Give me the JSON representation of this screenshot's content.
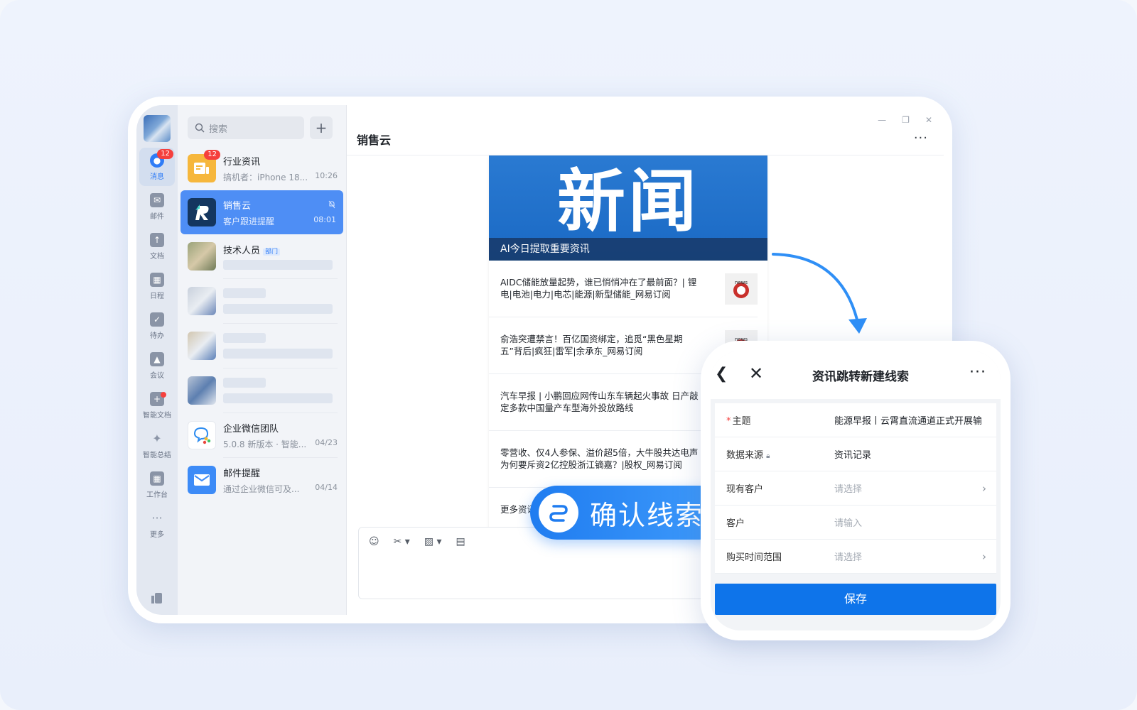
{
  "rail": {
    "items": [
      {
        "label": "消息",
        "icon": "chat-bubble-icon",
        "badge": "12",
        "active": true
      },
      {
        "label": "邮件",
        "icon": "mail-icon"
      },
      {
        "label": "文档",
        "icon": "document-icon"
      },
      {
        "label": "日程",
        "icon": "calendar-icon"
      },
      {
        "label": "待办",
        "icon": "todo-check-icon"
      },
      {
        "label": "会议",
        "icon": "meeting-icon"
      },
      {
        "label": "智能文档",
        "icon": "smart-doc-icon",
        "dot": true
      },
      {
        "label": "智能总结",
        "icon": "sparkle-icon"
      },
      {
        "label": "工作台",
        "icon": "grid-apps-icon"
      },
      {
        "label": "更多",
        "icon": "more-dots-icon"
      }
    ]
  },
  "search": {
    "placeholder": "搜索"
  },
  "sessions": [
    {
      "name": "行业资讯",
      "preview": "搞机者：iPhone 18...",
      "time": "10:26",
      "badge": "12"
    },
    {
      "name": "销售云",
      "preview": "客户跟进提醒",
      "time": "08:01",
      "active": true,
      "muted": true
    },
    {
      "name": "技术人员",
      "tag": "部门"
    },
    {
      "name": "企业微信团队",
      "preview": "5.0.8 新版本 · 智能...",
      "time": "04/23"
    },
    {
      "name": "邮件提醒",
      "preview": "通过企业微信可及...",
      "time": "04/14"
    }
  ],
  "chat": {
    "title": "销售云",
    "more": "···",
    "news": {
      "banner_title": "新闻",
      "banner_subtitle": "AI今日提取重要资讯",
      "items": [
        {
          "text": "AIDC储能放量起势，谁已悄悄冲在了最前面？| 锂电|电池|电力|电芯|能源|新型储能_网易订阅"
        },
        {
          "text": "俞浩突遭禁言！百亿国资绑定，追觅“黑色星期五”背后|疯狂|雷军|余承东_网易订阅"
        },
        {
          "text": "汽车早报 | 小鹏回应网传山东车辆起火事故 日产敲定多款中国量产车型海外投放路线"
        },
        {
          "text": "零营收、仅4人参保、溢价超5倍，大牛股共达电声为何要斥资2亿控股浙江镝嘉？|股权_网易订阅"
        }
      ],
      "more_label": "更多资讯"
    }
  },
  "pill": {
    "label": "确认线索"
  },
  "phone": {
    "title": "资讯跳转新建线索",
    "more": "···",
    "fields": [
      {
        "label": "主题",
        "required": true,
        "value": "能源早报丨云霄直流通道正式开展输",
        "placeholder": false
      },
      {
        "label": "数据来源",
        "locked": true,
        "value": "资讯记录",
        "placeholder": false
      },
      {
        "label": "现有客户",
        "value": "请选择",
        "placeholder": true,
        "chevron": true
      },
      {
        "label": "客户",
        "value": "请输入",
        "placeholder": true
      },
      {
        "label": "购买时间范围",
        "value": "请选择",
        "placeholder": true,
        "chevron": true
      }
    ],
    "save_label": "保存"
  },
  "colors": {
    "accent": "#2f7cf6",
    "save": "#0e74ea",
    "pill": "#1f7cf0",
    "badge": "#f5403d"
  }
}
